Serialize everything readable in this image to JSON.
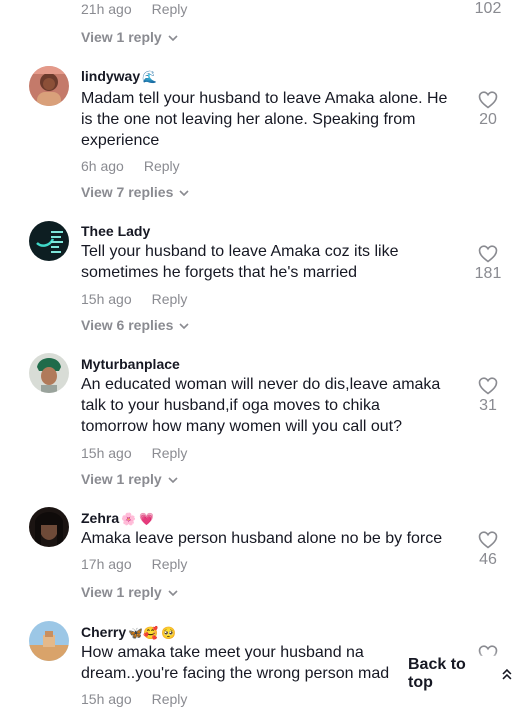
{
  "top_partial": {
    "time": "21h ago",
    "reply_label": "Reply",
    "like_count": "102",
    "view_replies": "View 1 reply"
  },
  "comments": [
    {
      "username": "lindyway",
      "emoji": "🌊",
      "lines": [
        "Madam tell your husband to leave Amaka alone. He",
        "is the one not leaving her alone. Speaking from",
        "experience"
      ],
      "time": "6h ago",
      "reply_label": "Reply",
      "like_count": "20",
      "view_replies": "View 7 replies"
    },
    {
      "username": "Thee Lady",
      "emoji": "",
      "lines": [
        "Tell your husband to leave Amaka coz its like",
        "sometimes he forgets that he's married"
      ],
      "time": "15h ago",
      "reply_label": "Reply",
      "like_count": "181",
      "view_replies": "View 6 replies"
    },
    {
      "username": "Myturbanplace",
      "emoji": "",
      "lines": [
        "An educated woman will never do dis,leave amaka",
        "talk to your husband,if oga moves to chika",
        "tomorrow how many women will you call out?"
      ],
      "time": "15h ago",
      "reply_label": "Reply",
      "like_count": "31",
      "view_replies": "View 1 reply"
    },
    {
      "username": "Zehra",
      "emoji": "🌸 💗",
      "lines": [
        "Amaka leave person husband alone no be by force"
      ],
      "time": "17h ago",
      "reply_label": "Reply",
      "like_count": "46",
      "view_replies": "View 1 reply"
    },
    {
      "username": "Cherry",
      "emoji": "🦋🥰 🥺",
      "lines": [
        "How amaka take meet your husband na",
        "dream..you're facing the wrong person mad"
      ],
      "time": "15h ago",
      "reply_label": "Reply",
      "like_count": "",
      "view_replies": ""
    }
  ],
  "back_to_top": {
    "label": "Back to top",
    "icon": "double-chevron-up-icon"
  },
  "colors": {
    "text": "#161823",
    "muted": "#8a8b91",
    "heart": "#8a8b91"
  }
}
